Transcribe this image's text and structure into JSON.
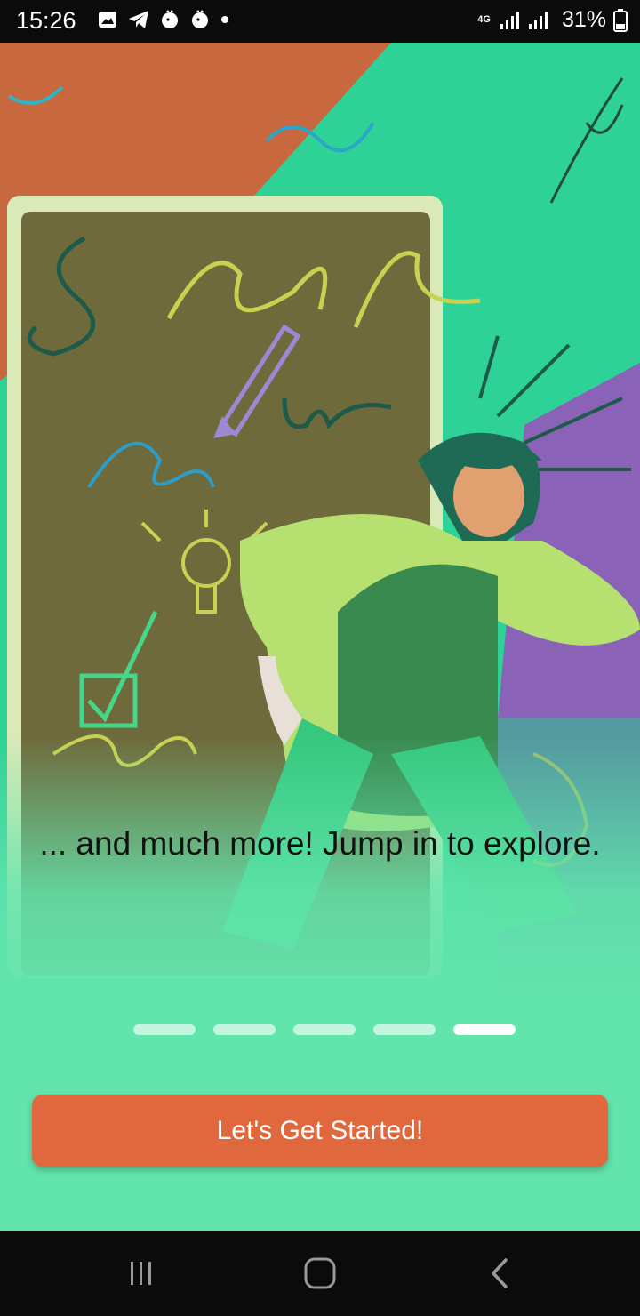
{
  "status_bar": {
    "time": "15:26",
    "network_type": "4G",
    "battery_percent": "31%",
    "icons": [
      "gallery-icon",
      "telegram-icon",
      "premier-league-icon",
      "premier-league-icon",
      "dot-icon",
      "signal-icon",
      "signal-icon",
      "battery-icon"
    ]
  },
  "onboarding": {
    "headline": "... and much more! Jump in to explore.",
    "page_indicator": {
      "total": 5,
      "current": 5
    },
    "cta_label": "Let's Get Started!"
  },
  "colors": {
    "background": "#62e5ad",
    "cta": "#e0683c",
    "illustration_orange": "#c8683e",
    "illustration_teal": "#1fc68a",
    "illustration_purple": "#8a63b8",
    "chalkboard": "#6a6a3a"
  },
  "nav_bar": {
    "buttons": [
      "recents-icon",
      "home-icon",
      "back-icon"
    ]
  }
}
